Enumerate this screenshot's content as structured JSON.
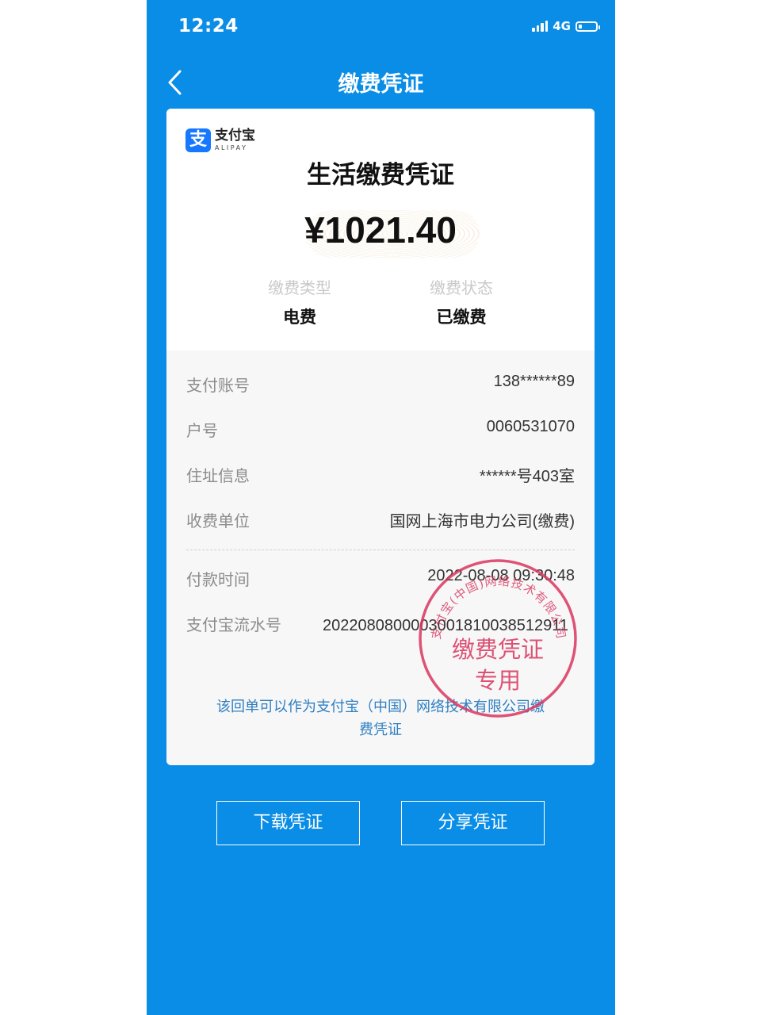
{
  "status_bar": {
    "time": "12:24",
    "network": "4G"
  },
  "nav": {
    "title": "缴费凭证"
  },
  "logo": {
    "cn": "支付宝",
    "en": "ALIPAY",
    "mark": "支"
  },
  "receipt": {
    "title": "生活缴费凭证",
    "amount": "¥1021.40",
    "fee_type_label": "缴费类型",
    "fee_type_value": "电费",
    "fee_status_label": "缴费状态",
    "fee_status_value": "已缴费"
  },
  "details": [
    {
      "label": "支付账号",
      "value": "138******89"
    },
    {
      "label": "户号",
      "value": "0060531070"
    },
    {
      "label": "住址信息",
      "value": "******号403室"
    },
    {
      "label": "收费单位",
      "value": "国网上海市电力公司(缴费)"
    }
  ],
  "payment": {
    "time_label": "付款时间",
    "time_value": "2022-08-08 09:30:48",
    "serial_label": "支付宝流水号",
    "serial_value": "2022080800003001810038512911"
  },
  "note": "该回单可以作为支付宝（中国）网络技术有限公司缴费凭证",
  "stamp": {
    "ring_text": "支付宝(中国)网络技术有限公司",
    "line1": "缴费凭证",
    "line2": "专用",
    "color": "#d9365e"
  },
  "buttons": {
    "download": "下载凭证",
    "share": "分享凭证"
  },
  "colors": {
    "header_blue": "#0a8de6",
    "note_blue": "#2f7fc0"
  }
}
